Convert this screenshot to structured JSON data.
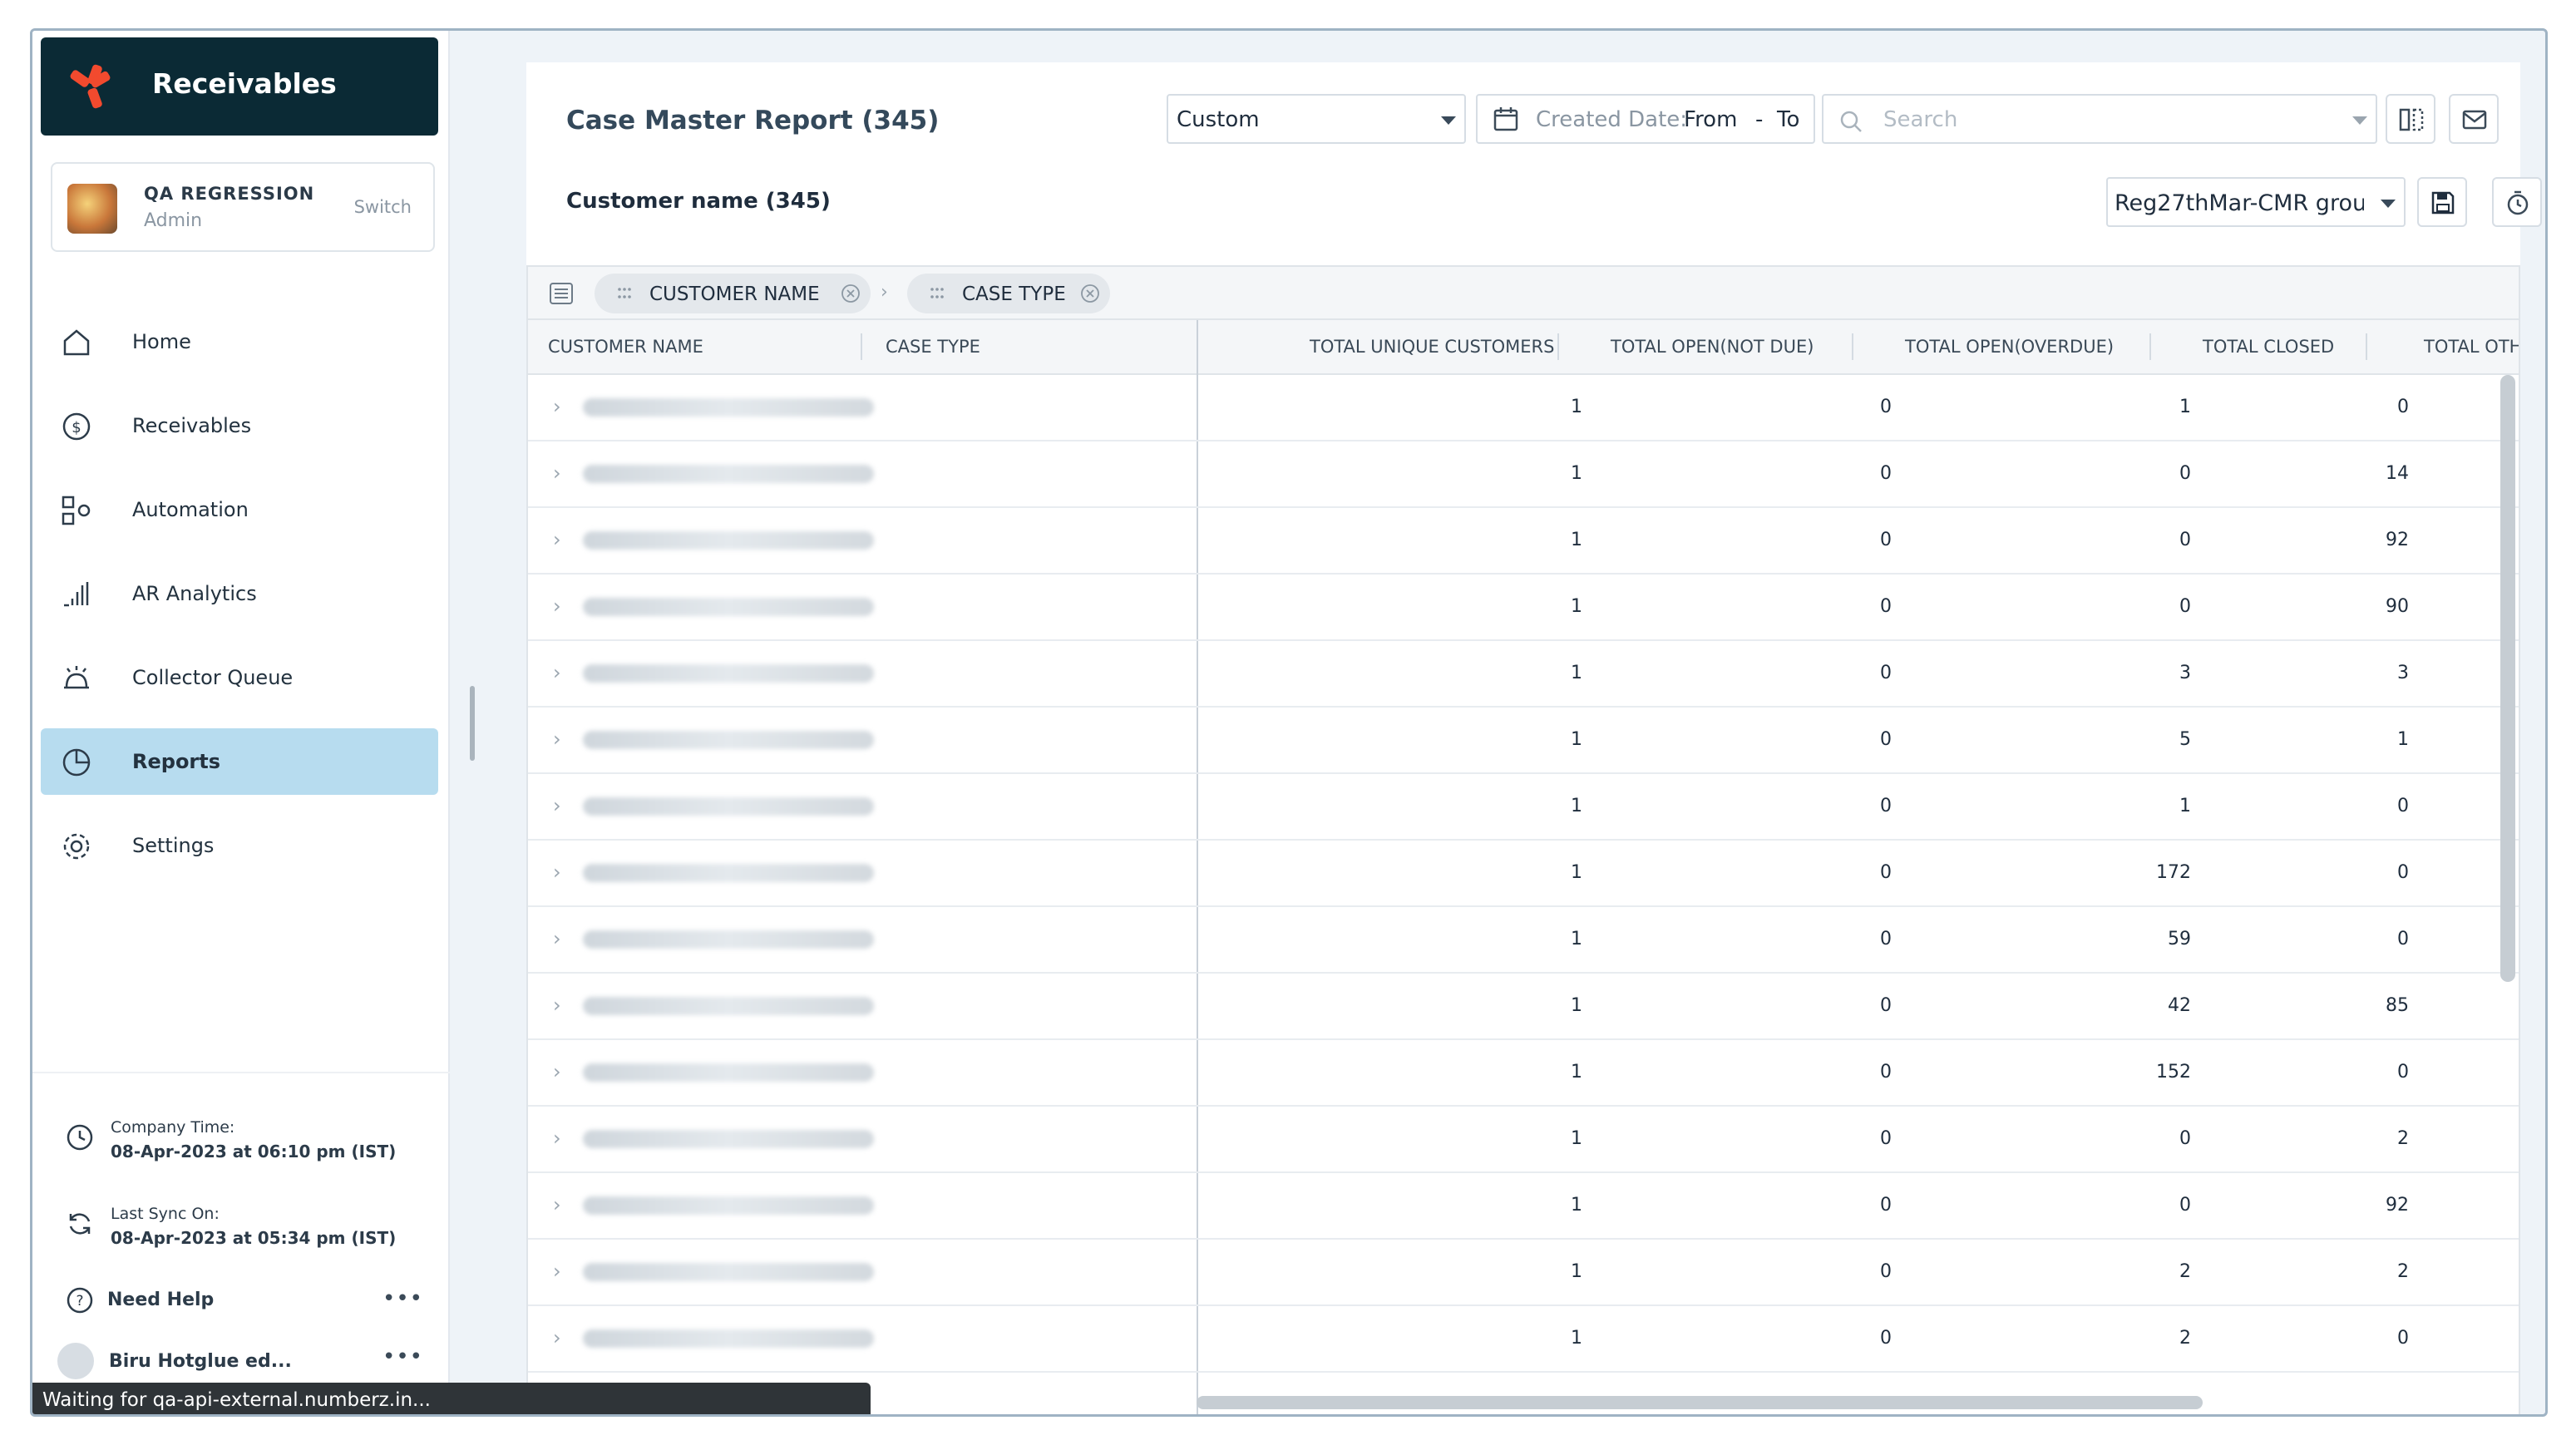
{
  "app": {
    "name": "Receivables"
  },
  "account": {
    "org": "QA REGRESSION",
    "role": "Admin",
    "switch_label": "Switch"
  },
  "nav": [
    {
      "label": "Home",
      "icon": "home-icon",
      "active": false
    },
    {
      "label": "Receivables",
      "icon": "dollar-icon",
      "active": false
    },
    {
      "label": "Automation",
      "icon": "automation-icon",
      "active": false
    },
    {
      "label": "AR Analytics",
      "icon": "analytics-icon",
      "active": false
    },
    {
      "label": "Collector Queue",
      "icon": "bell-icon",
      "active": false
    },
    {
      "label": "Reports",
      "icon": "pie-chart-icon",
      "active": true
    },
    {
      "label": "Settings",
      "icon": "gear-icon",
      "active": false
    }
  ],
  "company_time": {
    "label": "Company Time:",
    "value": "08-Apr-2023 at 06:10 pm (IST)"
  },
  "last_sync": {
    "label": "Last Sync On:",
    "value": "08-Apr-2023 at 05:34 pm (IST)"
  },
  "help": {
    "label": "Need Help",
    "more": "•••"
  },
  "user": {
    "name": "Biru Hotglue ed...",
    "more": "•••"
  },
  "status_bar": "Waiting for qa-api-external.numberz.in...",
  "report": {
    "title": "Case Master Report (345)",
    "range_select": "Custom",
    "date_label": "Created Date:",
    "date_from": "From",
    "date_sep": "-",
    "date_to": "To",
    "search_placeholder": "Search",
    "subtitle": "Customer name (345)",
    "view_select": "Reg27thMar-CMR grou"
  },
  "grouping": {
    "chips": [
      "CUSTOMER NAME",
      "CASE TYPE"
    ]
  },
  "table": {
    "columns": [
      "CUSTOMER NAME",
      "CASE TYPE",
      "TOTAL UNIQUE CUSTOMERS",
      "TOTAL OPEN(NOT DUE)",
      "TOTAL OPEN(OVERDUE)",
      "TOTAL CLOSED",
      "TOTAL OTHER"
    ],
    "rows": [
      [
        "1",
        "0",
        "1",
        "0"
      ],
      [
        "1",
        "0",
        "0",
        "14"
      ],
      [
        "1",
        "0",
        "0",
        "92"
      ],
      [
        "1",
        "0",
        "0",
        "90"
      ],
      [
        "1",
        "0",
        "3",
        "3"
      ],
      [
        "1",
        "0",
        "5",
        "1"
      ],
      [
        "1",
        "0",
        "1",
        "0"
      ],
      [
        "1",
        "0",
        "172",
        "0"
      ],
      [
        "1",
        "0",
        "59",
        "0"
      ],
      [
        "1",
        "0",
        "42",
        "85"
      ],
      [
        "1",
        "0",
        "152",
        "0"
      ],
      [
        "1",
        "0",
        "0",
        "2"
      ],
      [
        "1",
        "0",
        "0",
        "92"
      ],
      [
        "1",
        "0",
        "2",
        "2"
      ],
      [
        "1",
        "0",
        "2",
        "0"
      ]
    ]
  },
  "colors": {
    "brand_dark": "#0b2a35",
    "brand_accent": "#f24a2e",
    "active_nav": "#b7dcef"
  }
}
